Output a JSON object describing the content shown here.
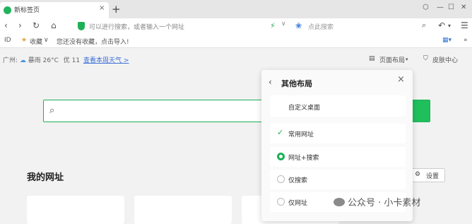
{
  "tab": {
    "title": "新标签页",
    "close": "×",
    "new_tab": "+"
  },
  "window": {
    "skin": "⬡",
    "minimize": "—",
    "maximize": "☐",
    "close": "✕"
  },
  "toolbar": {
    "back": "‹",
    "forward": "›",
    "reload": "↻",
    "home": "⌂",
    "address_placeholder": "可以进行搜索，或者输入一个网址",
    "bolt": "⚡",
    "chevron": "∨",
    "search_placeholder": "点此搜索",
    "undo": "↶",
    "undo_chevron": "▾",
    "menu": "☰"
  },
  "bookmarks": {
    "sidebar_toggle": "ID",
    "favorites_label": "收藏",
    "import_hint": "您还没有收藏，点击导入!",
    "apps": "▦▾"
  },
  "weather": {
    "city": "广州:",
    "condition": "暴雨 26°C",
    "aqi": "优 11",
    "forecast_link": "查看本周天气 >"
  },
  "page_tools": {
    "layout_label": "页面布局",
    "skin_label": "皮肤中心"
  },
  "layout_panel": {
    "title": "其他布局",
    "back": "‹",
    "close": "×",
    "custom_desktop": "自定义桌面",
    "options": [
      {
        "label": "常用网址",
        "state": "checked"
      },
      {
        "label": "网址+搜索",
        "state": "selected"
      },
      {
        "label": "仅搜索",
        "state": "none"
      },
      {
        "label": "仅网址",
        "state": "none"
      }
    ]
  },
  "main": {
    "my_sites_title": "我的网址",
    "settings_label": "设置"
  },
  "watermark": {
    "text": "公众号 · 小卡素材"
  },
  "colors": {
    "accent": "#1db057",
    "link": "#3a6fd6"
  }
}
